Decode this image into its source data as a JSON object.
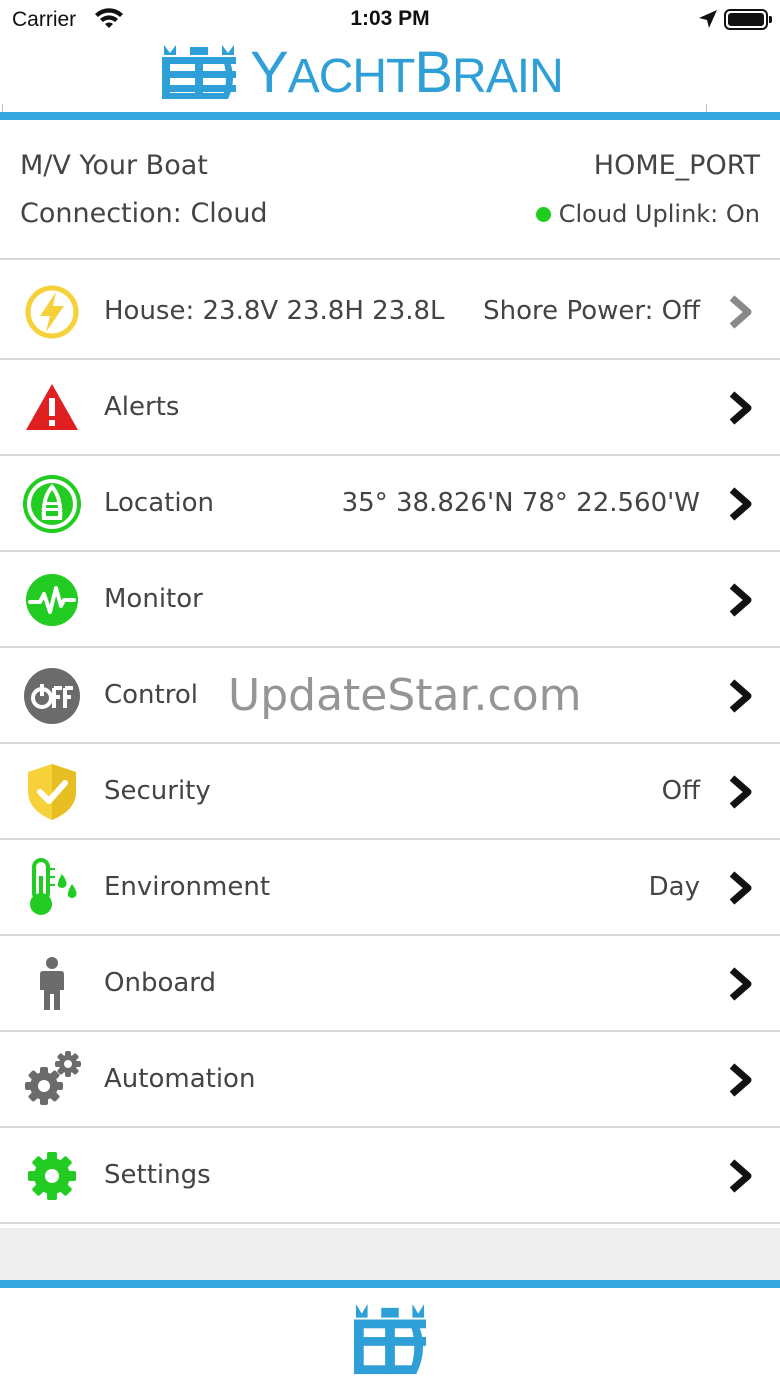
{
  "status_bar": {
    "carrier": "Carrier",
    "time": "1:03 PM"
  },
  "header": {
    "logo_word_first": "Yacht",
    "logo_word_second": "Brain",
    "logo_color": "#2f9fd8"
  },
  "boat": {
    "name": "M/V Your Boat",
    "connection": "Connection: Cloud",
    "home_port": "HOME_PORT",
    "uplink": "Cloud Uplink: On",
    "uplink_color": "#1fcc1f"
  },
  "menu": [
    {
      "label": "House: 23.8V 23.8H 23.8L",
      "value": "Shore Power: Off",
      "icon": "lightning-icon",
      "chevron_color": "#888888"
    },
    {
      "label": "Alerts",
      "value": "",
      "icon": "warning-icon",
      "chevron_color": "#111111"
    },
    {
      "label": "Location",
      "value": "35° 38.826'N 78° 22.560'W",
      "icon": "boat-icon",
      "chevron_color": "#111111"
    },
    {
      "label": "Monitor",
      "value": "",
      "icon": "heartbeat-icon",
      "chevron_color": "#111111"
    },
    {
      "label": "Control",
      "value": "",
      "icon": "power-off-icon",
      "chevron_color": "#111111"
    },
    {
      "label": "Security",
      "value": "Off",
      "icon": "shield-icon",
      "chevron_color": "#111111"
    },
    {
      "label": "Environment",
      "value": "Day",
      "icon": "thermometer-icon",
      "chevron_color": "#111111"
    },
    {
      "label": "Onboard",
      "value": "",
      "icon": "person-icon",
      "chevron_color": "#111111"
    },
    {
      "label": "Automation",
      "value": "",
      "icon": "gears-icon",
      "chevron_color": "#111111"
    },
    {
      "label": "Settings",
      "value": "",
      "icon": "gear-icon",
      "chevron_color": "#111111"
    }
  ],
  "watermark": "UpdateStar.com",
  "colors": {
    "accent": "#36a7e0",
    "green": "#22cc22",
    "yellow": "#f7d13a",
    "red": "#e02020",
    "grey": "#6b6b6b"
  }
}
